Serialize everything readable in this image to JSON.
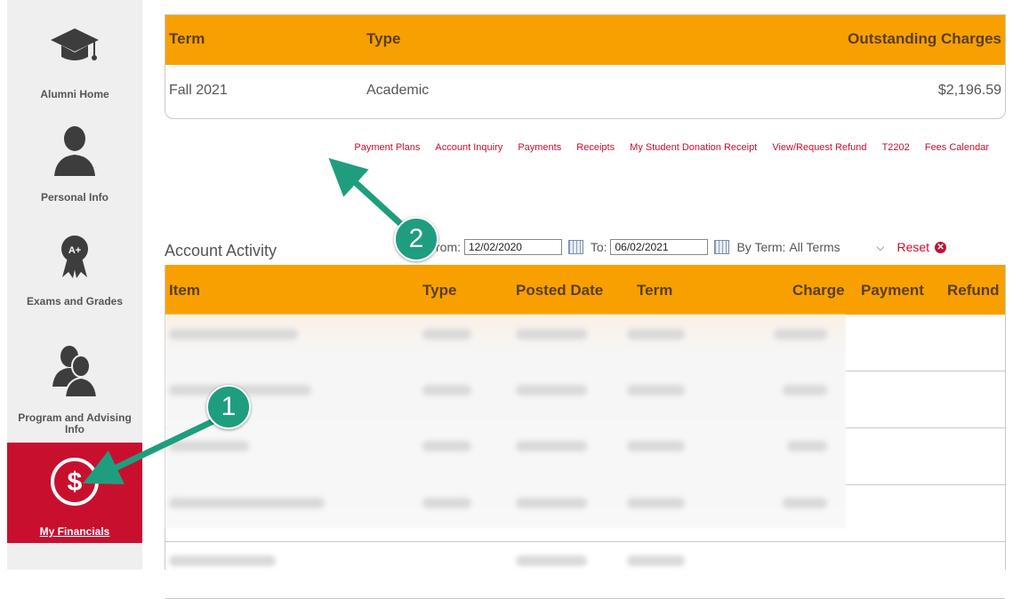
{
  "sidebar": {
    "items": [
      {
        "label": "Alumni Home",
        "icon": "graduation-cap-icon"
      },
      {
        "label": "Personal Info",
        "icon": "person-icon"
      },
      {
        "label": "Exams and Grades",
        "icon": "award-ribbon-icon",
        "badge": "A+"
      },
      {
        "label": "Program and Advising Info",
        "icon": "people-icon"
      },
      {
        "label": "My Financials",
        "icon": "dollar-icon",
        "active": true
      }
    ]
  },
  "charges": {
    "headers": {
      "term": "Term",
      "type": "Type",
      "outstanding": "Outstanding Charges"
    },
    "rows": [
      {
        "term": "Fall 2021",
        "type": "Academic",
        "outstanding": "$2,196.59"
      }
    ]
  },
  "links": [
    "Payment Plans",
    "Account Inquiry",
    "Payments",
    "Receipts",
    "My Student Donation Receipt",
    "View/Request Refund",
    "T2202",
    "Fees Calendar"
  ],
  "activity": {
    "title": "Account Activity",
    "from_label": "rom:",
    "from_value": "12/02/2020",
    "to_label": "To:",
    "to_value": "06/02/2021",
    "term_label": "By Term:",
    "term_value": "All Terms",
    "reset_label": "Reset",
    "headers": {
      "item": "Item",
      "type": "Type",
      "posted": "Posted Date",
      "term": "Term",
      "charge": "Charge",
      "payment": "Payment",
      "refund": "Refund"
    }
  },
  "callouts": {
    "one": "1",
    "two": "2"
  },
  "colors": {
    "accent": "#f7a000",
    "brand_red": "#c8102e",
    "callout": "#1e9e7e"
  }
}
